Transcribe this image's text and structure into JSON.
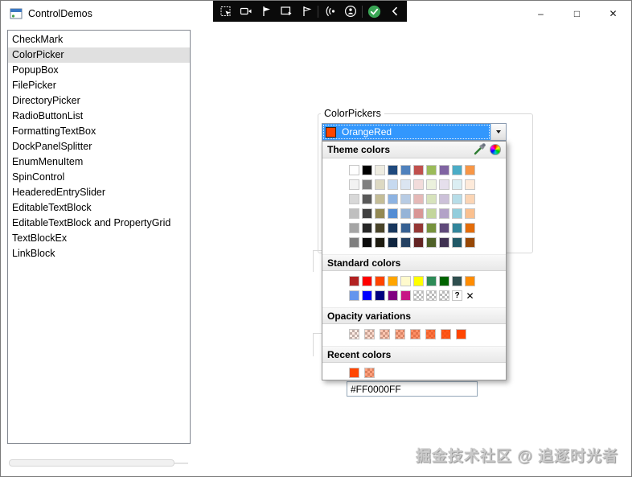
{
  "window": {
    "title": "ControlDemos",
    "buttons": [
      {
        "name": "minimize",
        "glyph": "–"
      },
      {
        "name": "maximize",
        "glyph": "□"
      },
      {
        "name": "close",
        "glyph": "✕"
      }
    ]
  },
  "titlebar": {
    "toolbar_icons": [
      "region-capture",
      "video-camera",
      "flag-cursor",
      "rect-select",
      "flag-outline",
      "audio-waves",
      "person-circle",
      "check-circle",
      "chevron-left"
    ]
  },
  "sidebar": {
    "selected_index": 1,
    "items": [
      "CheckMark",
      "ColorPicker",
      "PopupBox",
      "FilePicker",
      "DirectoryPicker",
      "RadioButtonList",
      "FormattingTextBox",
      "DockPanelSplitter",
      "EnumMenuItem",
      "SpinControl",
      "HeaderedEntrySlider",
      "EditableTextBlock",
      "EditableTextBlock and PropertyGrid",
      "TextBlockEx",
      "LinkBlock"
    ]
  },
  "main": {
    "group_label": "ColorPickers",
    "combo": {
      "selected_color_name": "OrangeRed",
      "selected_color": "#FF4500",
      "highlight_color": "#3297FD"
    },
    "popup": {
      "theme_header": "Theme colors",
      "theme_rows": [
        [
          "#FFFFFF",
          "#000000",
          "#EEECE1",
          "#1F497D",
          "#4F81BD",
          "#C0504D",
          "#9BBB59",
          "#8064A2",
          "#4BACC6",
          "#F79646"
        ],
        [
          "#F2F2F2",
          "#7F7F7F",
          "#DDD9C3",
          "#C6D9F0",
          "#DBE5F1",
          "#F2DCDB",
          "#EBF1DD",
          "#E5DFEC",
          "#DBEEF3",
          "#FDEADA"
        ],
        [
          "#D8D8D8",
          "#595959",
          "#C4BD97",
          "#8DB3E2",
          "#B8CCE4",
          "#E5B9B7",
          "#D7E3BC",
          "#CCC1D9",
          "#B7DDE8",
          "#FBD5B5"
        ],
        [
          "#BFBFBF",
          "#3F3F3F",
          "#938953",
          "#548DD4",
          "#95B3D7",
          "#D99694",
          "#C3D69B",
          "#B2A2C7",
          "#92CDDC",
          "#FAC08F"
        ],
        [
          "#A5A5A5",
          "#262626",
          "#494429",
          "#17365D",
          "#366092",
          "#953734",
          "#76923C",
          "#5F497A",
          "#31859B",
          "#E36C09"
        ],
        [
          "#7F7F7F",
          "#0C0C0C",
          "#1D1B10",
          "#0F243E",
          "#244061",
          "#632423",
          "#4F6128",
          "#3F3151",
          "#215967",
          "#974806"
        ]
      ],
      "standard_header": "Standard colors",
      "standard_rows": [
        [
          {
            "c": "#B22222"
          },
          {
            "c": "#FF0000"
          },
          {
            "c": "#FF4500"
          },
          {
            "c": "#FFA500"
          },
          {
            "c": "#FFFACD"
          },
          {
            "c": "#FFFF00"
          },
          {
            "c": "#2E8B57"
          },
          {
            "c": "#006400"
          },
          {
            "c": "#2F4F4F"
          },
          {
            "c": "#FF8C00"
          }
        ],
        [
          {
            "c": "#6495ED"
          },
          {
            "c": "#0000FF"
          },
          {
            "c": "#000080"
          },
          {
            "c": "#800080"
          },
          {
            "c": "#C71585"
          },
          {
            "t": "checker"
          },
          {
            "t": "checker"
          },
          {
            "t": "checker"
          },
          {
            "t": "question",
            "label": "?"
          },
          {
            "t": "clear",
            "label": "✕"
          }
        ]
      ],
      "opacity_header": "Opacity variations",
      "opacity_base": "#FF4500",
      "opacity_alphas": [
        0.1,
        0.2,
        0.3,
        0.45,
        0.6,
        0.75,
        0.9,
        1
      ],
      "recent_header": "Recent colors",
      "recent_colors": [
        {
          "color": "#FF4500",
          "alpha": 1
        },
        {
          "color": "#FF4500",
          "alpha": 0.5
        }
      ]
    },
    "hex_input": {
      "value": "#FF0000FF"
    }
  },
  "watermark": "掘金技术社区 @ 追逐时光者"
}
